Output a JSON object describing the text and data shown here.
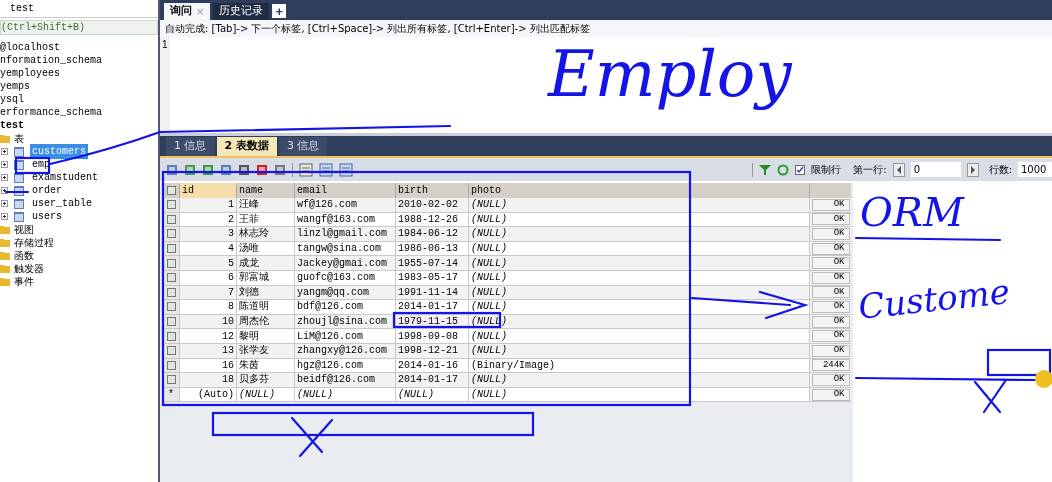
{
  "sidebar": {
    "title": "test",
    "filter_hint": "(Ctrl+Shift+B)",
    "connection": "@localhost",
    "databases": [
      {
        "label": "nformation_schema"
      },
      {
        "label": "yemployees"
      },
      {
        "label": "yemps"
      },
      {
        "label": "ysql"
      },
      {
        "label": "erformance_schema"
      },
      {
        "label": "test",
        "children": [
          {
            "label": "表",
            "kind": "folder",
            "children": [
              {
                "label": "customers",
                "selected": true
              },
              {
                "label": "emp",
                "selected": false
              },
              {
                "label": "examstudent",
                "selected": false
              },
              {
                "label": "order",
                "selected": false
              },
              {
                "label": "user_table",
                "selected": false
              },
              {
                "label": "users",
                "selected": false
              }
            ]
          },
          {
            "label": "视图",
            "kind": "folder"
          },
          {
            "label": "存储过程",
            "kind": "folder"
          },
          {
            "label": "函数",
            "kind": "folder"
          },
          {
            "label": "触发器",
            "kind": "folder"
          },
          {
            "label": "事件",
            "kind": "folder"
          }
        ]
      }
    ]
  },
  "editor_tabs": [
    {
      "label": "询问",
      "selected": true,
      "close": "×"
    },
    {
      "label": "历史记录",
      "selected": false
    }
  ],
  "new_tab": "+",
  "hint": "自动完成: [Tab]-> 下一个标签, [Ctrl+Space]-> 列出所有标签, [Ctrl+Enter]-> 列出匹配标签",
  "editor": {
    "line_number": "1"
  },
  "result_tabs": [
    {
      "label": "1 信息",
      "selected": false
    },
    {
      "label": "2 表数据",
      "selected": true
    },
    {
      "label": "3 信息",
      "selected": false
    }
  ],
  "limit": {
    "checked": true,
    "label": "限制行",
    "first_row_label": "第一行:",
    "first_row": "0",
    "rows_label": "行数:",
    "rows": "1000"
  },
  "table": {
    "all_checked": false,
    "columns": [
      "id",
      "name",
      "email",
      "birth",
      "photo"
    ],
    "rows": [
      {
        "checked": false,
        "cells": [
          "1",
          "汪峰",
          "wf@126.com",
          "2010-02-02",
          {
            "text": "(NULL)",
            "italic": true
          }
        ],
        "blob": "OK"
      },
      {
        "checked": false,
        "cells": [
          "2",
          "王菲",
          "wangf@163.com",
          "1988-12-26",
          {
            "text": "(NULL)",
            "italic": true
          }
        ],
        "blob": "OK"
      },
      {
        "checked": false,
        "cells": [
          "3",
          "林志玲",
          "linzl@gmail.com",
          "1984-06-12",
          {
            "text": "(NULL)",
            "italic": true
          }
        ],
        "blob": "OK"
      },
      {
        "checked": false,
        "cells": [
          "4",
          "汤唯",
          "tangw@sina.com",
          "1986-06-13",
          {
            "text": "(NULL)",
            "italic": true
          }
        ],
        "blob": "OK"
      },
      {
        "checked": false,
        "cells": [
          "5",
          "成龙",
          "Jackey@gmai.com",
          "1955-07-14",
          {
            "text": "(NULL)",
            "italic": true
          }
        ],
        "blob": "OK"
      },
      {
        "checked": false,
        "cells": [
          "6",
          "郭富城",
          "guofc@163.com",
          "1983-05-17",
          {
            "text": "(NULL)",
            "italic": true
          }
        ],
        "blob": "OK"
      },
      {
        "checked": false,
        "cells": [
          "7",
          "刘德",
          "yangm@qq.com",
          "1991-11-14",
          {
            "text": "(NULL)",
            "italic": true
          }
        ],
        "blob": "OK"
      },
      {
        "checked": false,
        "cells": [
          "8",
          "陈道明",
          "bdf@126.com",
          "2014-01-17",
          {
            "text": "(NULL)",
            "italic": true
          }
        ],
        "blob": "OK"
      },
      {
        "checked": false,
        "cells": [
          "10",
          "周杰伦",
          "zhoujl@sina.com",
          "1979-11-15",
          {
            "text": "(NULL)",
            "italic": true
          }
        ],
        "blob": "OK"
      },
      {
        "checked": false,
        "cells": [
          "12",
          "黎明",
          "LiM@126.com",
          "1998-09-08",
          {
            "text": "(NULL)",
            "italic": true
          }
        ],
        "blob": "OK"
      },
      {
        "checked": false,
        "cells": [
          "13",
          "张学友",
          "zhangxy@126.com",
          "1998-12-21",
          {
            "text": "(NULL)",
            "italic": true
          }
        ],
        "blob": "OK"
      },
      {
        "checked": false,
        "cells": [
          "16",
          "朱茵",
          "hgz@126.com",
          "2014-01-16",
          "(Binary/Image)"
        ],
        "blob": "244K"
      },
      {
        "checked": false,
        "cells": [
          "18",
          "贝多芬",
          "beidf@126.com",
          "2014-01-17",
          {
            "text": "(NULL)",
            "italic": true
          }
        ],
        "blob": "OK"
      },
      {
        "marker": "*",
        "cells": [
          "(Auto)",
          {
            "text": "(NULL)",
            "italic": true
          },
          {
            "text": "(NULL)",
            "italic": true
          },
          {
            "text": "(NULL)",
            "italic": true
          },
          {
            "text": "(NULL)",
            "italic": true
          }
        ],
        "blob": "OK"
      }
    ]
  },
  "annotations": [
    {
      "text": "Employ"
    },
    {
      "text": "ORM"
    },
    {
      "text": "Custome"
    }
  ]
}
